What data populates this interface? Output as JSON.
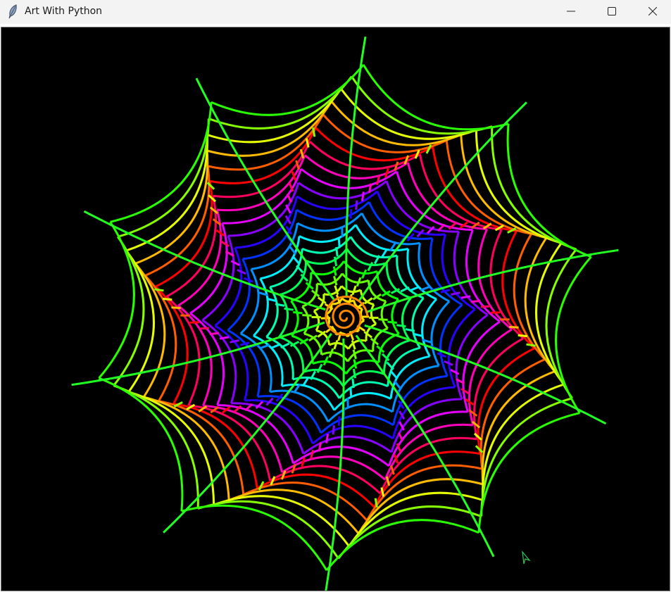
{
  "window": {
    "title": "Art With Python",
    "app_icon": "feather-icon",
    "controls": {
      "minimize": "minimize-icon",
      "maximize": "maximize-icon",
      "close": "close-icon"
    }
  },
  "canvas": {
    "background": "#000000",
    "drawing": "rainbow-spider-web",
    "arms": 10,
    "turtle_cursor": "arrow-icon"
  }
}
